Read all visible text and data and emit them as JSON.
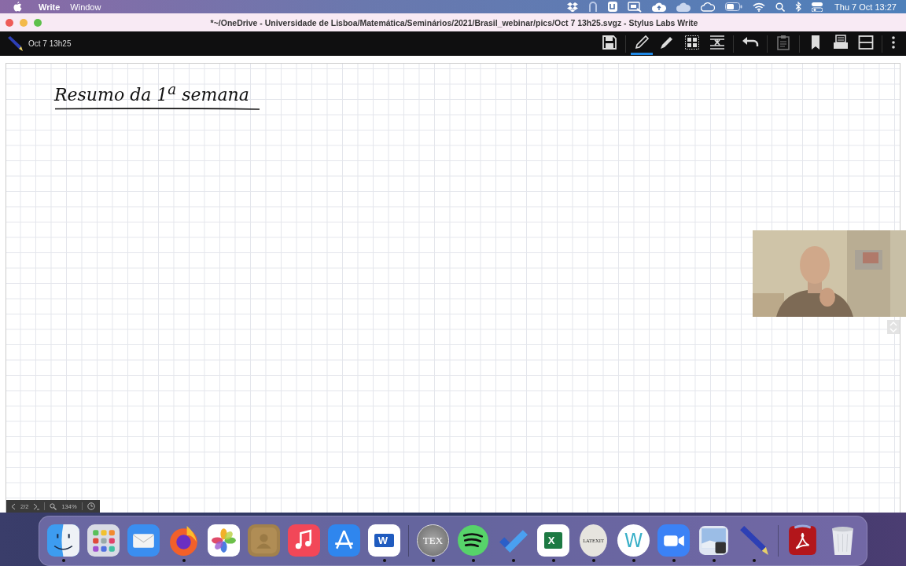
{
  "menu_bar": {
    "app_name": "Write",
    "menus": [
      "Window"
    ],
    "clock": "Thu 7 Oct  13:27"
  },
  "window": {
    "title": "*~/OneDrive - Universidade de Lisboa/Matemática/Seminários/2021/Brasil_webinar/pics/Oct  7 13h25.svgz - Stylus Labs Write"
  },
  "toolbar": {
    "document_name": "Oct  7 13h25",
    "tools": [
      {
        "kind": "save",
        "selected": false
      },
      {
        "kind": "pen",
        "selected": true
      },
      {
        "kind": "highlighter",
        "selected": false
      },
      {
        "kind": "grid",
        "selected": false
      },
      {
        "kind": "spacing",
        "selected": false
      },
      {
        "kind": "undo",
        "selected": false
      },
      {
        "kind": "clipboard",
        "selected": false
      },
      {
        "kind": "bookmark",
        "selected": false
      },
      {
        "kind": "archive",
        "selected": false
      },
      {
        "kind": "layout",
        "selected": false
      },
      {
        "kind": "more",
        "selected": false
      }
    ]
  },
  "page": {
    "heading": "Resumo da 1$^{a}$ semana"
  },
  "status_bar": {
    "page": "2/2",
    "zoom": "134%"
  },
  "dock": [
    {
      "kind": "finder",
      "running": true
    },
    {
      "kind": "launchpad",
      "running": false
    },
    {
      "kind": "mail",
      "running": false
    },
    {
      "kind": "firefox",
      "running": true
    },
    {
      "kind": "photos",
      "running": false
    },
    {
      "kind": "contacts",
      "running": false
    },
    {
      "kind": "music",
      "running": false
    },
    {
      "kind": "appstore",
      "running": false
    },
    {
      "kind": "word",
      "running": true,
      "glyph": "W"
    },
    {
      "kind": "separator"
    },
    {
      "kind": "tex",
      "running": true,
      "glyph": "TEX"
    },
    {
      "kind": "spotify",
      "running": true
    },
    {
      "kind": "todo",
      "running": true
    },
    {
      "kind": "excel",
      "running": true,
      "glyph": "X"
    },
    {
      "kind": "latexit",
      "running": true,
      "glyph": "LATEXIT"
    },
    {
      "kind": "write",
      "running": true,
      "glyph": "W"
    },
    {
      "kind": "zoom",
      "running": true
    },
    {
      "kind": "preview",
      "running": true
    },
    {
      "kind": "pencil",
      "running": true
    },
    {
      "kind": "separator"
    },
    {
      "kind": "acrobat",
      "running": false
    },
    {
      "kind": "trash",
      "running": false
    }
  ]
}
